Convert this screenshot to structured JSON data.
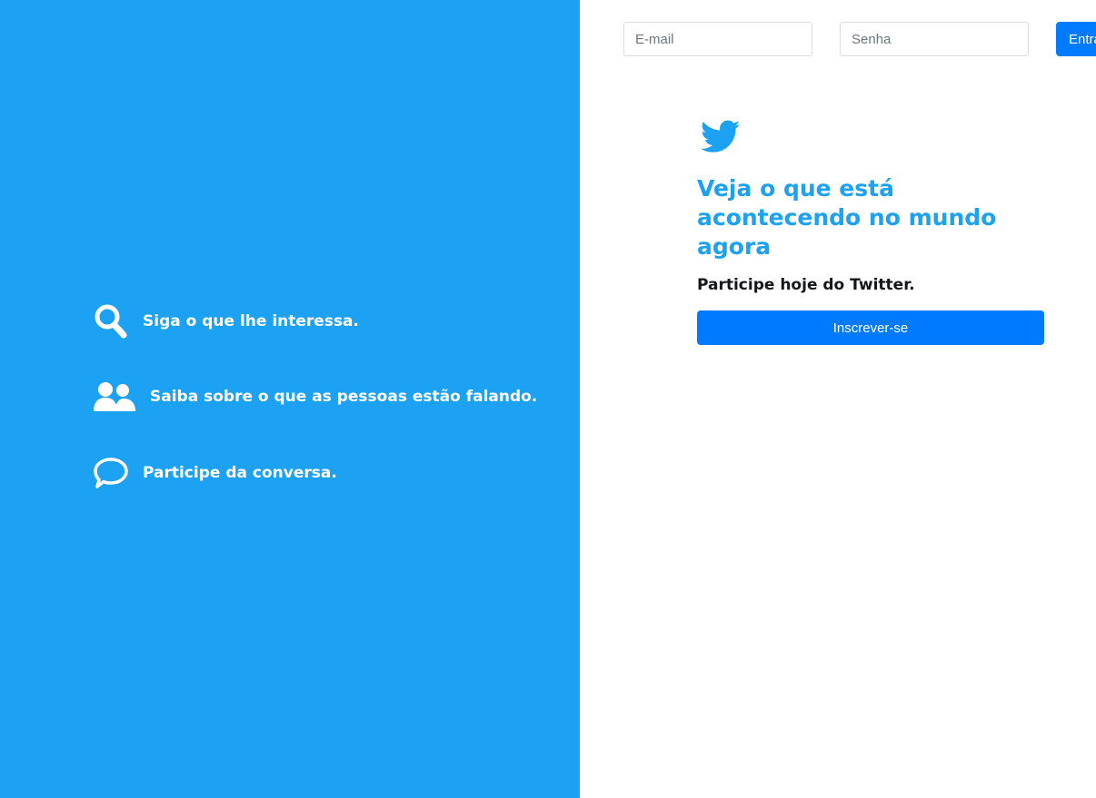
{
  "features": [
    {
      "icon": "search-icon",
      "label": "Siga o que lhe interessa."
    },
    {
      "icon": "users-icon",
      "label": "Saiba sobre o que as pessoas estão falando."
    },
    {
      "icon": "chat-bubble-icon",
      "label": "Participe da conversa."
    }
  ],
  "login": {
    "email_placeholder": "E-mail",
    "password_placeholder": "Senha",
    "submit_label": "Entrar"
  },
  "hero": {
    "logo_icon": "twitter-bird-icon",
    "headline": "Veja o que está acontecendo no mundo agora",
    "join_text": "Participe hoje do Twitter.",
    "signup_label": "Inscrever-se"
  },
  "colors": {
    "brand_blue": "#1da1f2",
    "button_blue": "#007bff",
    "white": "#ffffff",
    "dark_text": "#14171a"
  }
}
